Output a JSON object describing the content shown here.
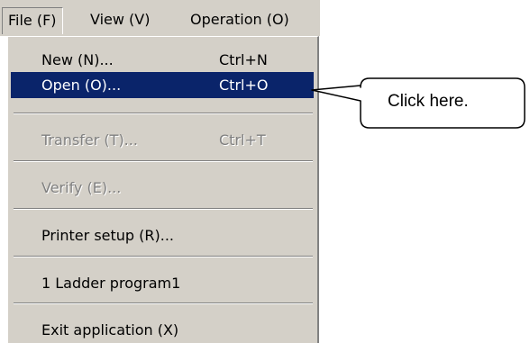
{
  "menubar": {
    "items": [
      {
        "label": "File (F)"
      },
      {
        "label": "View (V)"
      },
      {
        "label": "Operation (O)"
      }
    ]
  },
  "file_menu": {
    "new": {
      "label": "New (N)...",
      "shortcut": "Ctrl+N"
    },
    "open": {
      "label": "Open (O)...",
      "shortcut": "Ctrl+O",
      "state": "highlighted"
    },
    "transfer": {
      "label": "Transfer (T)...",
      "shortcut": "Ctrl+T",
      "state": "disabled"
    },
    "verify": {
      "label": "Verify (E)...",
      "state": "disabled"
    },
    "printer_setup": {
      "label": "Printer setup (R)..."
    },
    "recent_file": {
      "label": "1 Ladder program1"
    },
    "exit": {
      "label": "Exit application (X)"
    }
  },
  "callout": {
    "text": "Click here."
  },
  "colors": {
    "menu_bg": "#d4d0c8",
    "highlight_bg": "#0a246a",
    "disabled_text": "#808080"
  }
}
